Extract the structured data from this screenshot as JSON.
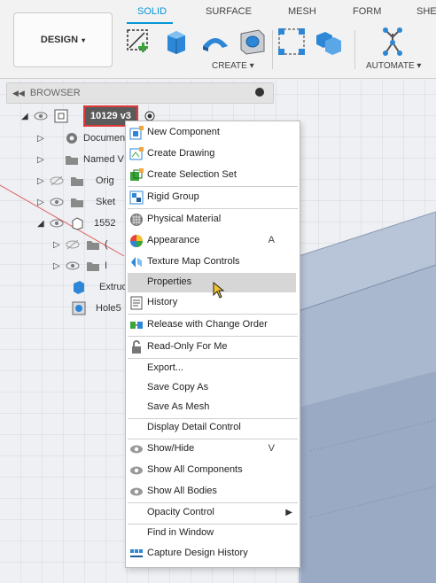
{
  "toolbar": {
    "workspace": "DESIGN",
    "tabs": [
      {
        "label": "SOLID",
        "active": true
      },
      {
        "label": "SURFACE"
      },
      {
        "label": "MESH"
      },
      {
        "label": "FORM"
      },
      {
        "label": "SHE"
      }
    ],
    "create_label": "CREATE",
    "automate_label": "AUTOMATE",
    "caret": "▾"
  },
  "browser": {
    "collapse_arrows": "◀◀",
    "title": "BROWSER",
    "selected_component": "10129 v3",
    "rows": [
      {
        "label": "Documen"
      },
      {
        "label": "Named V"
      },
      {
        "label": "Orig"
      },
      {
        "label": "Sket"
      },
      {
        "label": "1552"
      },
      {
        "label": "("
      },
      {
        "label": "I"
      },
      {
        "label": "Extrud"
      },
      {
        "label": "Hole5"
      }
    ]
  },
  "menu": {
    "items": [
      {
        "label": "New Component",
        "icon": "new-component-icon"
      },
      {
        "label": "Create Drawing",
        "icon": "drawing-icon"
      },
      {
        "label": "Create Selection Set",
        "icon": "selection-set-icon"
      },
      {
        "label": "Rigid Group",
        "icon": "rigid-group-icon"
      },
      {
        "label": "Physical Material",
        "icon": "material-icon"
      },
      {
        "label": "Appearance",
        "icon": "appearance-icon",
        "shortcut": "A"
      },
      {
        "label": "Texture Map Controls",
        "icon": "texture-map-icon"
      },
      {
        "label": "Properties"
      },
      {
        "label": "History",
        "icon": "history-icon"
      },
      {
        "label": "Release with Change Order",
        "icon": "release-icon"
      },
      {
        "label": "Read-Only For Me",
        "icon": "lock-icon"
      },
      {
        "label": "Export..."
      },
      {
        "label": "Save Copy As"
      },
      {
        "label": "Save As Mesh"
      },
      {
        "label": "Display Detail Control"
      },
      {
        "label": "Show/Hide",
        "icon": "eye-icon",
        "shortcut": "V"
      },
      {
        "label": "Show All Components",
        "icon": "eye-icon"
      },
      {
        "label": "Show All Bodies",
        "icon": "eye-icon"
      },
      {
        "label": "Opacity Control",
        "submenu": "▶"
      },
      {
        "label": "Find in Window"
      },
      {
        "label": "Capture Design History",
        "icon": "capture-history-icon"
      }
    ]
  },
  "colors": {
    "accent": "#0696d7",
    "highlight_box": "#e03a3a",
    "model_face": "#a9b7cf"
  }
}
